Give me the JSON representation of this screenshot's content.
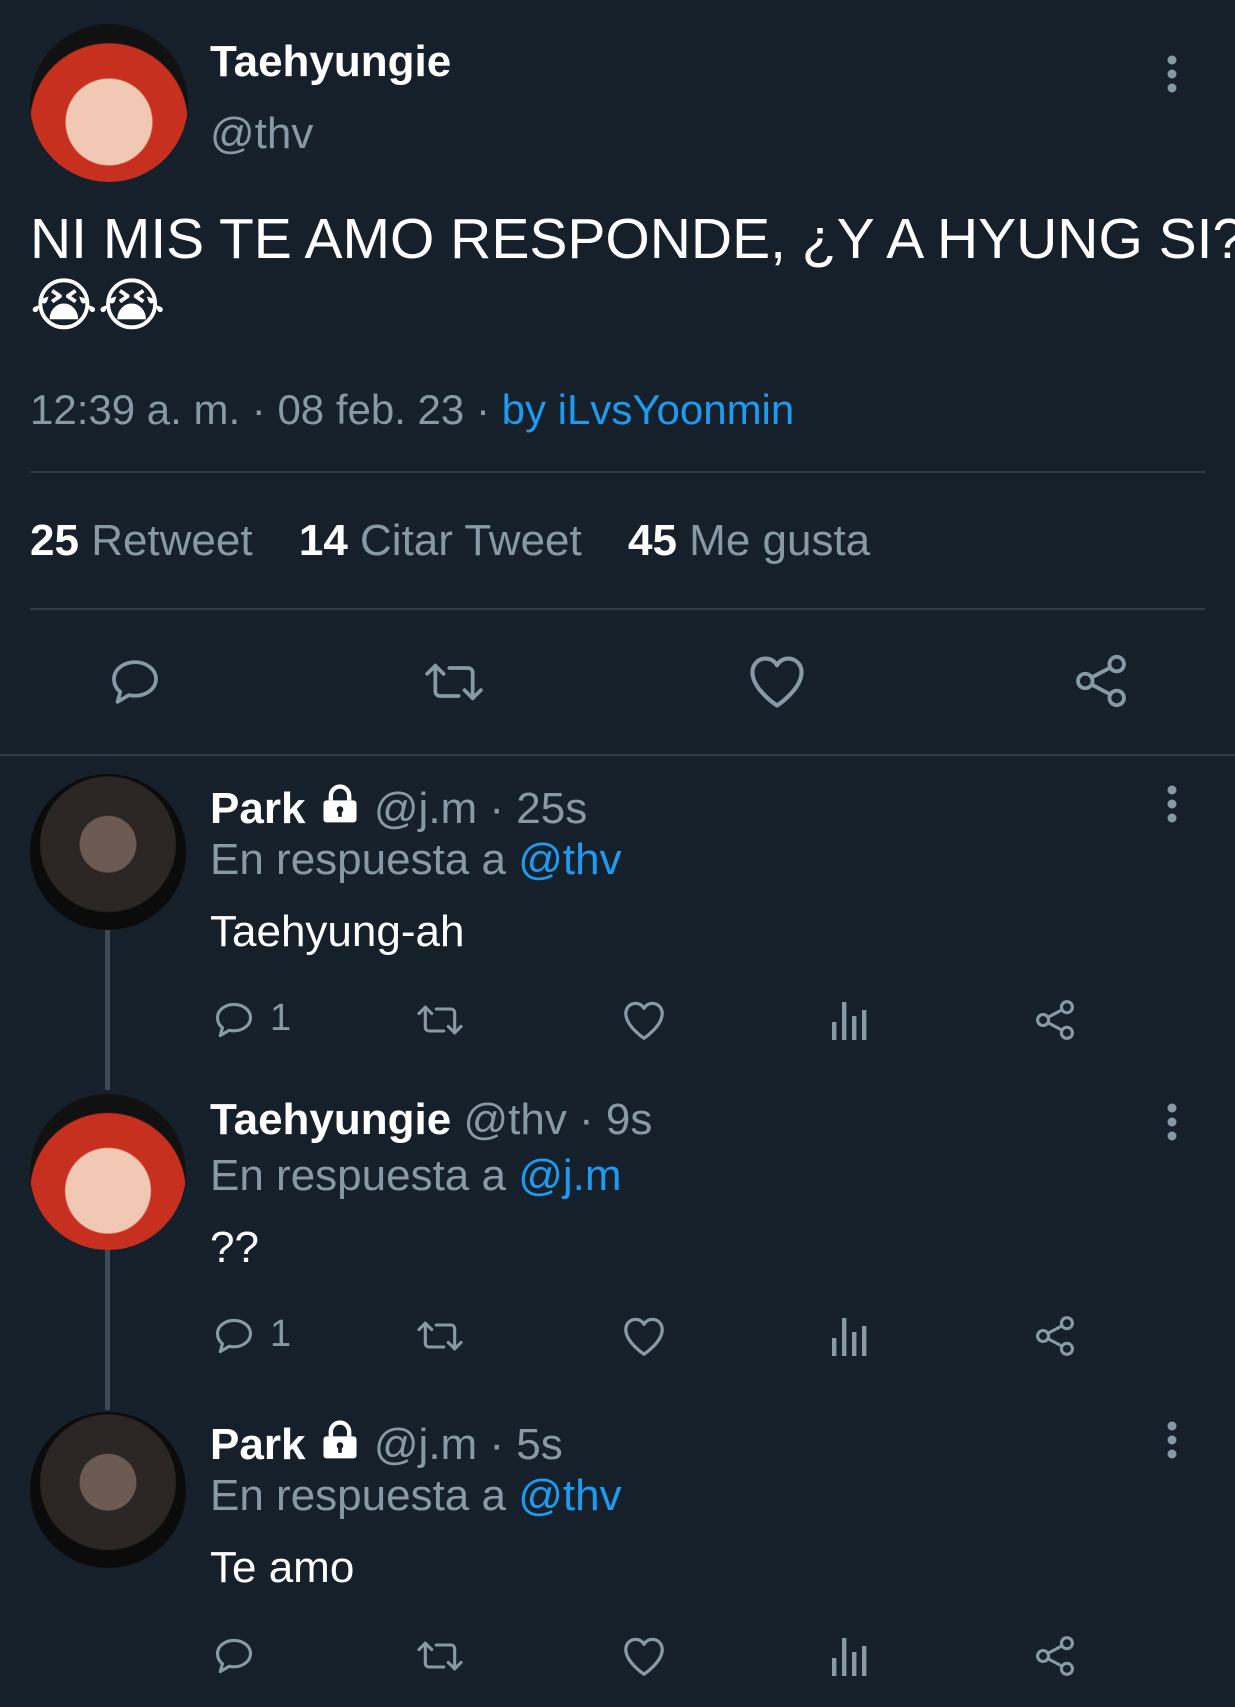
{
  "main_tweet": {
    "display_name": "Taehyungie",
    "handle": "@thv",
    "text": "NI MIS TE AMO RESPONDE, ¿Y A HYUNG SI?",
    "emojis": "😭😭",
    "timestamp": "12:39 a. m. · 08 feb. 23",
    "source_separator": "·",
    "source": "by iLvsYoonmin",
    "stats": [
      {
        "count": "25",
        "label": "Retweet"
      },
      {
        "count": "14",
        "label": "Citar Tweet"
      },
      {
        "count": "45",
        "label": "Me gusta"
      }
    ]
  },
  "replies": [
    {
      "display_name": "Park",
      "locked": true,
      "handle_time": "@j.m · 25s",
      "reply_prefix": "En respuesta a",
      "reply_to": "@thv",
      "text": "Taehyung-ah",
      "reply_count": "1"
    },
    {
      "display_name": "Taehyungie",
      "locked": false,
      "handle_time": "@thv · 9s",
      "reply_prefix": "En respuesta a",
      "reply_to": "@j.m",
      "text": "??",
      "reply_count": "1"
    },
    {
      "display_name": "Park",
      "locked": true,
      "handle_time": "@j.m · 5s",
      "reply_prefix": "En respuesta a",
      "reply_to": "@thv",
      "text": "Te amo",
      "reply_count": ""
    }
  ],
  "icons": {
    "reply": "speech-bubble-icon",
    "retweet": "retweet-icon",
    "like": "heart-icon",
    "analytics": "bar-chart-icon",
    "share": "share-icon",
    "more": "vertical-dots-icon",
    "lock": "lock-icon"
  },
  "colors": {
    "background": "#15202b",
    "link": "#1d9bf0",
    "muted": "#8899a6",
    "divider": "#2f3b47"
  }
}
